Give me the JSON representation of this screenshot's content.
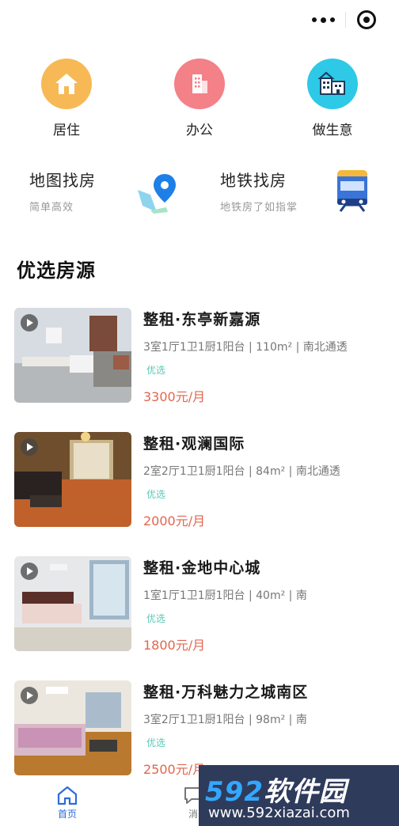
{
  "capsule": {
    "more_icon": "more-dots-icon",
    "close_icon": "target-close-icon"
  },
  "categories": [
    {
      "label": "居住",
      "icon": "house-icon",
      "color": "#f7b955"
    },
    {
      "label": "办公",
      "icon": "office-building-icon",
      "color": "#f48088"
    },
    {
      "label": "做生意",
      "icon": "shop-icon",
      "color": "#2dc9e6"
    }
  ],
  "finds": [
    {
      "title": "地图找房",
      "subtitle": "简单高效",
      "icon": "map-pin-icon"
    },
    {
      "title": "地铁找房",
      "subtitle": "地铁房了如指掌",
      "icon": "metro-train-icon"
    }
  ],
  "section_title": "优选房源",
  "listings": [
    {
      "name": "整租·东亭新嘉源",
      "spec": "3室1厅1卫1厨1阳台 | 110m² | 南北通透",
      "tag": "优选",
      "price": "3300元/月"
    },
    {
      "name": "整租·观澜国际",
      "spec": "2室2厅1卫1厨1阳台 | 84m² | 南北通透",
      "tag": "优选",
      "price": "2000元/月"
    },
    {
      "name": "整租·金地中心城",
      "spec": "1室1厅1卫1厨1阳台 | 40m² | 南",
      "tag": "优选",
      "price": "1800元/月"
    },
    {
      "name": "整租·万科魅力之城南区",
      "spec": "3室2厅1卫1厨1阳台 | 98m² | 南",
      "tag": "优选",
      "price": "2500元/月"
    }
  ],
  "tabbar": {
    "home_label": "首页",
    "msg_label": "消",
    "active_color": "#2f6bd9"
  },
  "watermark": {
    "brand_num": "592",
    "brand_cn": "软件园",
    "url": "www.592xiazai.com"
  }
}
